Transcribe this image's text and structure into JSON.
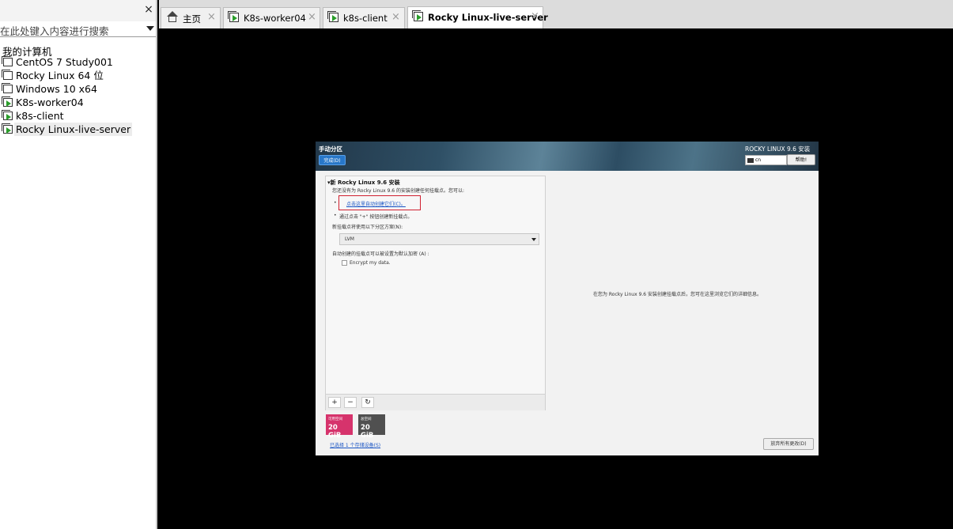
{
  "sidebar": {
    "close_glyph": "×",
    "search_placeholder": "在此处键入内容进行搜索",
    "root_label": "我的计算机",
    "items": [
      {
        "label": "CentOS 7 Study001",
        "state": "off"
      },
      {
        "label": "Rocky Linux 64 位",
        "state": "off"
      },
      {
        "label": "Windows 10 x64",
        "state": "off"
      },
      {
        "label": "K8s-worker04",
        "state": "running"
      },
      {
        "label": "k8s-client",
        "state": "running"
      },
      {
        "label": "Rocky Linux-live-server",
        "state": "running",
        "selected": true
      }
    ]
  },
  "tabs": [
    {
      "label": "主页",
      "icon": "home-icon",
      "close": "×"
    },
    {
      "label": "K8s-worker04",
      "icon": "vm-running-icon",
      "close": "×"
    },
    {
      "label": "k8s-client",
      "icon": "vm-running-icon",
      "close": "×"
    },
    {
      "label": "Rocky Linux-live-server",
      "icon": "vm-running-icon",
      "close": "×",
      "active": true
    }
  ],
  "installer": {
    "title": "手动分区",
    "done_button": "完成(D)",
    "os_title": "ROCKY LINUX 9.6 安装",
    "keyboard_layout": "cn",
    "help_button": "帮助!",
    "section_title": "▾新 Rocky Linux 9.6 安装",
    "no_mounts_text": "您还没有为 Rocky Linux 9.6 的安装创建任何挂载点。您可以:",
    "bullet": "•",
    "auto_create_link": "点击这里自动创建它们(C)。",
    "manual_create_text": "通过点击 \"+\" 按钮创建新挂载点。",
    "scheme_label": "新挂载点将使用以下分区方案(N):",
    "scheme_value": "LVM",
    "encrypt_label": "自动创建的挂载点可以被设置为默认加密 (A) :",
    "encrypt_checkbox": "Encrypt my data.",
    "add_button": "+",
    "remove_button": "−",
    "refresh_button": "↻",
    "available_space": {
      "label": "可用空间",
      "value": "20 GiB"
    },
    "total_space": {
      "label": "总空间",
      "value": "20 GiB"
    },
    "storage_link": "已选择 1 个存储设备(S)",
    "detail_text": "在您为 Rocky Linux 9.6 安装创建挂载点后，您可在这里浏览它们的详细信息。",
    "discard_button": "放弃所有更改(D)"
  },
  "colors": {
    "available_space": "#d6336c",
    "total_space": "#505050",
    "done_button": "#2877c9",
    "link": "#1a55c4",
    "highlight_box": "#d02030"
  }
}
